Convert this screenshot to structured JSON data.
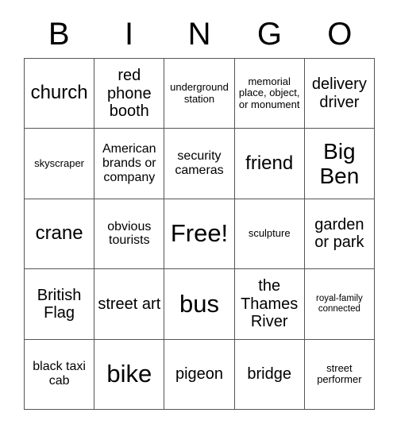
{
  "card": {
    "title": "BINGO",
    "header_letters": [
      "B",
      "I",
      "N",
      "G",
      "O"
    ],
    "columns": 5,
    "rows": 5,
    "background_color": "#ffffff",
    "text_color": "#000000",
    "border_color": "#555555",
    "cells": [
      {
        "text": "church",
        "size": "lg"
      },
      {
        "text": "red phone booth",
        "size": "md"
      },
      {
        "text": "underground station",
        "size": "xs"
      },
      {
        "text": "memorial place, object, or monument",
        "size": "xs"
      },
      {
        "text": "delivery driver",
        "size": "md"
      },
      {
        "text": "skyscraper",
        "size": "xs"
      },
      {
        "text": "American brands or company",
        "size": "sm"
      },
      {
        "text": "security cameras",
        "size": "sm"
      },
      {
        "text": "friend",
        "size": "lg"
      },
      {
        "text": "Big Ben",
        "size": "xl"
      },
      {
        "text": "crane",
        "size": "lg"
      },
      {
        "text": "obvious tourists",
        "size": "sm"
      },
      {
        "text": "Free!",
        "size": "xxl"
      },
      {
        "text": "sculpture",
        "size": "xs"
      },
      {
        "text": "garden or park",
        "size": "md"
      },
      {
        "text": "British Flag",
        "size": "md"
      },
      {
        "text": "street art",
        "size": "md"
      },
      {
        "text": "bus",
        "size": "xxl"
      },
      {
        "text": "the Thames River",
        "size": "md"
      },
      {
        "text": "royal-family connected",
        "size": "xxs"
      },
      {
        "text": "black taxi cab",
        "size": "sm"
      },
      {
        "text": "bike",
        "size": "xxl"
      },
      {
        "text": "pigeon",
        "size": "md"
      },
      {
        "text": "bridge",
        "size": "md"
      },
      {
        "text": "street performer",
        "size": "xs"
      }
    ]
  }
}
